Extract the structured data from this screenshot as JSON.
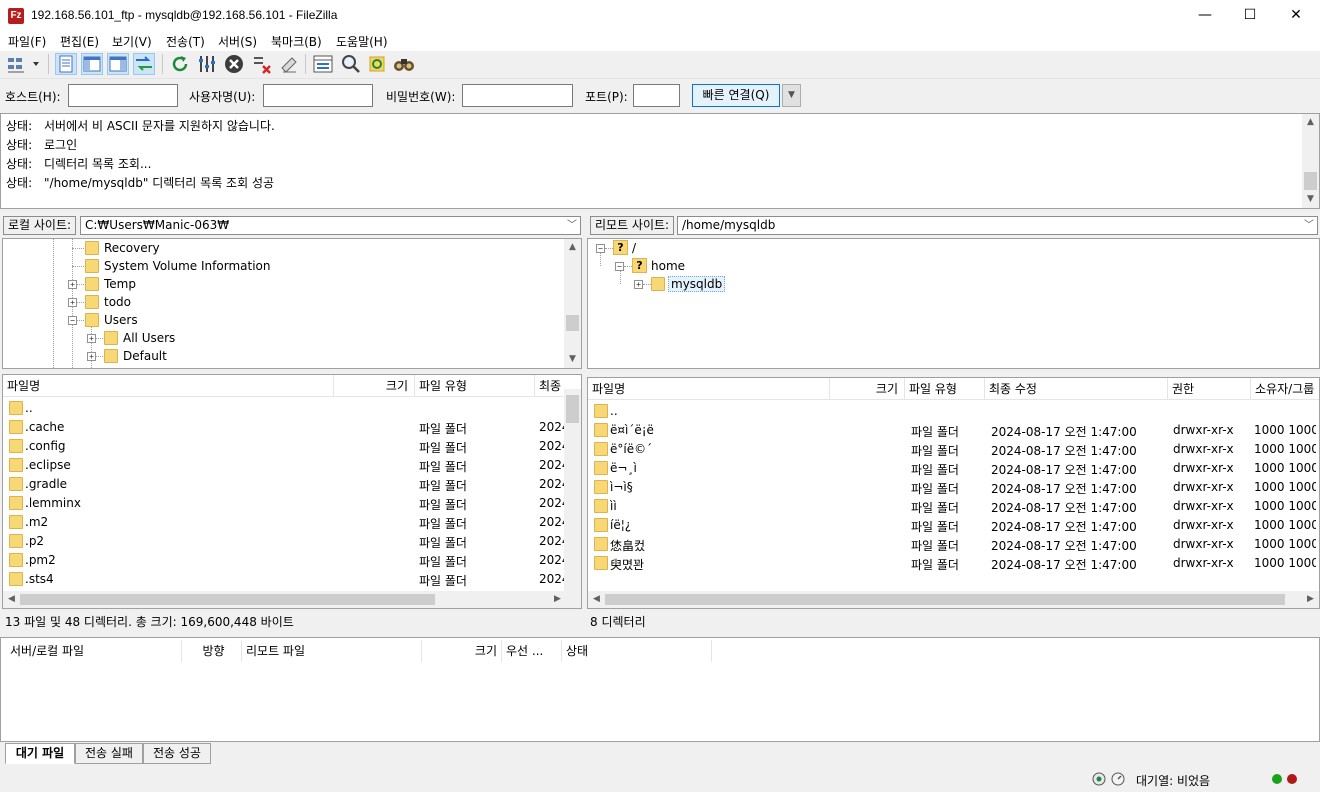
{
  "window": {
    "title": "192.168.56.101_ftp - mysqldb@192.168.56.101 - FileZilla",
    "app_icon_text": "Fz",
    "minimize": "—",
    "maximize": "☐",
    "close": "✕"
  },
  "menu": [
    "파일(F)",
    "편집(E)",
    "보기(V)",
    "전송(T)",
    "서버(S)",
    "북마크(B)",
    "도움말(H)"
  ],
  "toolbar": {
    "icons": [
      "site-manager-icon",
      "toggle-message-log-icon",
      "toggle-local-tree-icon",
      "toggle-remote-tree-icon",
      "toggle-queue-icon",
      "refresh-icon",
      "process-queue-icon",
      "cancel-icon",
      "disconnect-icon",
      "reconnect-icon",
      "directory-listing-filters-icon",
      "toggle-comparison-icon",
      "sync-browsing-icon",
      "search-icon"
    ]
  },
  "quickconnect": {
    "host_label": "호스트(H):",
    "host_value": "",
    "user_label": "사용자명(U):",
    "user_value": "",
    "pass_label": "비밀번호(W):",
    "pass_value": "",
    "port_label": "포트(P):",
    "port_value": "",
    "connect_label": "빠른 연결(Q)",
    "dropdown_glyph": "▼"
  },
  "log": [
    {
      "label": "상태:",
      "text": "서버에서 비 ASCII 문자를 지원하지 않습니다."
    },
    {
      "label": "상태:",
      "text": "로그인"
    },
    {
      "label": "상태:",
      "text": "디렉터리 목록 조회..."
    },
    {
      "label": "상태:",
      "text": "\"/home/mysqldb\" 디렉터리 목록 조회 성공"
    }
  ],
  "local": {
    "site_label": "로컬 사이트:",
    "path": "C:₩Users₩Manic-063₩",
    "tree": [
      {
        "name": "Recovery",
        "expander": ""
      },
      {
        "name": "System Volume Information",
        "expander": ""
      },
      {
        "name": "Temp",
        "expander": "+"
      },
      {
        "name": "todo",
        "expander": "+"
      },
      {
        "name": "Users",
        "expander": "−"
      },
      {
        "name": "All Users",
        "expander": "+"
      },
      {
        "name": "Default",
        "expander": "+"
      }
    ],
    "columns": [
      "파일명",
      "크기",
      "파일 유형",
      "최종"
    ],
    "files": [
      {
        "name": "..",
        "size": "",
        "type": "",
        "modified": ""
      },
      {
        "name": ".cache",
        "size": "",
        "type": "파일 폴더",
        "modified": "2024"
      },
      {
        "name": ".config",
        "size": "",
        "type": "파일 폴더",
        "modified": "2024"
      },
      {
        "name": ".eclipse",
        "size": "",
        "type": "파일 폴더",
        "modified": "2024"
      },
      {
        "name": ".gradle",
        "size": "",
        "type": "파일 폴더",
        "modified": "2024"
      },
      {
        "name": ".lemminx",
        "size": "",
        "type": "파일 폴더",
        "modified": "2024"
      },
      {
        "name": ".m2",
        "size": "",
        "type": "파일 폴더",
        "modified": "2024"
      },
      {
        "name": ".p2",
        "size": "",
        "type": "파일 폴더",
        "modified": "2024"
      },
      {
        "name": ".pm2",
        "size": "",
        "type": "파일 폴더",
        "modified": "2024"
      },
      {
        "name": ".sts4",
        "size": "",
        "type": "파일 폴더",
        "modified": "2024"
      }
    ],
    "status": "13 파일 및 48 디렉터리. 총 크기: 169,600,448 바이트"
  },
  "remote": {
    "site_label": "리모트 사이트:",
    "path": "/home/mysqldb",
    "tree": [
      {
        "name": "/",
        "expander": "−",
        "icon": "?"
      },
      {
        "name": "home",
        "expander": "−",
        "icon": "?"
      },
      {
        "name": "mysqldb",
        "expander": "+",
        "icon": "folder"
      }
    ],
    "columns": [
      "파일명",
      "크기",
      "파일 유형",
      "최종 수정",
      "권한",
      "소유자/그룹"
    ],
    "files": [
      {
        "name": "..",
        "type": "",
        "modified": "",
        "perms": "",
        "owner": ""
      },
      {
        "name": "ë¤ì´ë¡ë",
        "type": "파일 폴더",
        "modified": "2024-08-17 오전 1:47:00",
        "perms": "drwxr-xr-x",
        "owner": "1000 1000"
      },
      {
        "name": "ë°íë©´",
        "type": "파일 폴더",
        "modified": "2024-08-17 오전 1:47:00",
        "perms": "drwxr-xr-x",
        "owner": "1000 1000"
      },
      {
        "name": "ë¬¸ì",
        "type": "파일 폴더",
        "modified": "2024-08-17 오전 1:47:00",
        "perms": "drwxr-xr-x",
        "owner": "1000 1000"
      },
      {
        "name": "ì¬ì§",
        "type": "파일 폴더",
        "modified": "2024-08-17 오전 1:47:00",
        "perms": "drwxr-xr-x",
        "owner": "1000 1000"
      },
      {
        "name": "ìì",
        "type": "파일 폴더",
        "modified": "2024-08-17 오전 1:47:00",
        "perms": "drwxr-xr-x",
        "owner": "1000 1000"
      },
      {
        "name": "íë¦¿",
        "type": "파일 폴더",
        "modified": "2024-08-17 오전 1:47:00",
        "perms": "drwxr-xr-x",
        "owner": "1000 1000"
      },
      {
        "name": "恷畠컸",
        "type": "파일 폴더",
        "modified": "2024-08-17 오전 1:47:00",
        "perms": "drwxr-xr-x",
        "owner": "1000 1000"
      },
      {
        "name": "臾몄꽌",
        "type": "파일 폴더",
        "modified": "2024-08-17 오전 1:47:00",
        "perms": "drwxr-xr-x",
        "owner": "1000 1000"
      }
    ],
    "status": "8 디렉터리"
  },
  "queue": {
    "columns": [
      "서버/로컬 파일",
      "방향",
      "리모트 파일",
      "크기",
      "우선 ...",
      "상태"
    ],
    "tabs": [
      "대기 파일",
      "전송 실패",
      "전송 성공"
    ]
  },
  "statusbar": {
    "queue_text": "대기열: 비었음",
    "indicator_colors": [
      "#1aa21a",
      "#b11818"
    ]
  }
}
